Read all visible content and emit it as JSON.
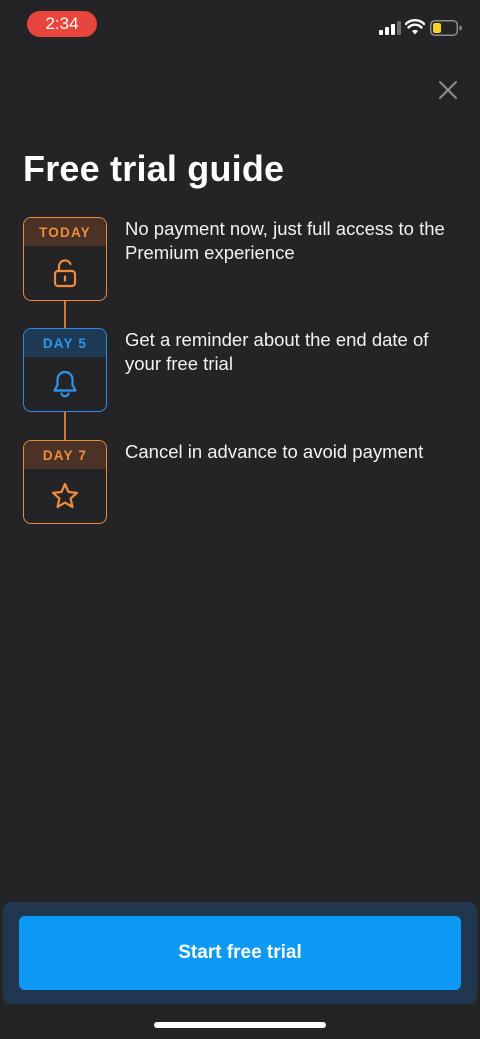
{
  "status_bar": {
    "time": "2:34"
  },
  "header": {
    "title": "Free trial guide"
  },
  "steps": [
    {
      "label": "TODAY",
      "icon": "unlock-icon",
      "text": "No payment now, just full access to the Premium experience",
      "accent": "#f08c3d"
    },
    {
      "label": "DAY 5",
      "icon": "bell-icon",
      "text": "Get a reminder about the end date of your free trial",
      "accent": "#2f95ef"
    },
    {
      "label": "DAY 7",
      "icon": "star-icon",
      "text": "Cancel in advance to avoid payment",
      "accent": "#f08c3d"
    }
  ],
  "footer": {
    "cta_label": "Start free trial"
  },
  "colors": {
    "background": "#242326",
    "primary_button": "#0d9af7",
    "orange_accent": "#f08c3d",
    "blue_accent": "#2f95ef",
    "status_time_pill": "#e8453c",
    "battery_level": "#f5d327"
  }
}
